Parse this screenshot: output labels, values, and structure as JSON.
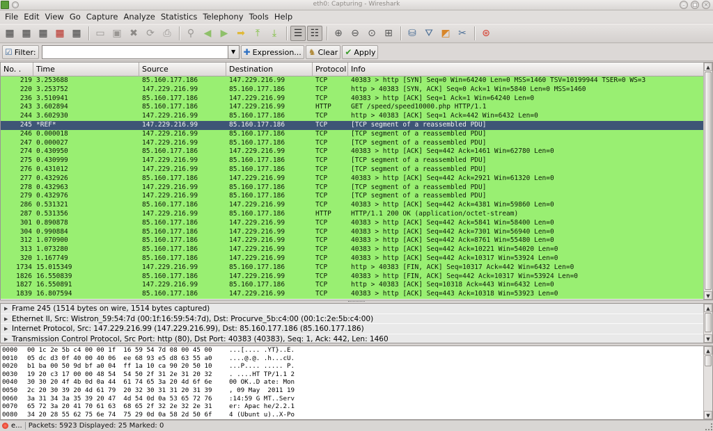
{
  "window": {
    "title": "eth0: Capturing - Wireshark"
  },
  "menu": [
    "File",
    "Edit",
    "View",
    "Go",
    "Capture",
    "Analyze",
    "Statistics",
    "Telephony",
    "Tools",
    "Help"
  ],
  "toolbar": [
    {
      "name": "interfaces-icon",
      "glyph": "▦",
      "color": "#3a3a3a"
    },
    {
      "name": "capture-options-icon",
      "glyph": "▦",
      "color": "#3a3a3a"
    },
    {
      "name": "start-capture-icon",
      "glyph": "▦",
      "color": "#3a3a3a"
    },
    {
      "name": "stop-capture-icon",
      "glyph": "▦",
      "color": "#b7261d"
    },
    {
      "name": "restart-capture-icon",
      "glyph": "▦",
      "color": "#3a3a3a"
    },
    {
      "sep": true
    },
    {
      "name": "open-icon",
      "glyph": "▭",
      "color": "#9a9794"
    },
    {
      "name": "save-icon",
      "glyph": "▣",
      "color": "#9a9794"
    },
    {
      "name": "close-file-icon",
      "glyph": "✖",
      "color": "#8c8986"
    },
    {
      "name": "reload-icon",
      "glyph": "⟳",
      "color": "#9a9794"
    },
    {
      "name": "print-icon",
      "glyph": "⎙",
      "color": "#9a9794"
    },
    {
      "sep": true
    },
    {
      "name": "find-icon",
      "glyph": "⚲",
      "color": "#9a9794"
    },
    {
      "name": "back-icon",
      "glyph": "◀",
      "color": "#8fc06a"
    },
    {
      "name": "forward-icon",
      "glyph": "▶",
      "color": "#8fc06a"
    },
    {
      "name": "go-to-packet-icon",
      "glyph": "➡",
      "color": "#e0b93a"
    },
    {
      "name": "first-packet-icon",
      "glyph": "⤒",
      "color": "#7bbf3a"
    },
    {
      "name": "last-packet-icon",
      "glyph": "⤓",
      "color": "#7bbf3a"
    },
    {
      "sep": true
    },
    {
      "name": "colorize-icon",
      "glyph": "☰",
      "color": "#2f2f2f",
      "pressed": true
    },
    {
      "name": "auto-scroll-icon",
      "glyph": "☷",
      "color": "#2f2f2f",
      "pressed": true
    },
    {
      "sep": true
    },
    {
      "name": "zoom-in-icon",
      "glyph": "⊕",
      "color": "#555"
    },
    {
      "name": "zoom-out-icon",
      "glyph": "⊖",
      "color": "#555"
    },
    {
      "name": "normal-size-icon",
      "glyph": "⊙",
      "color": "#555"
    },
    {
      "name": "resize-columns-icon",
      "glyph": "⊞",
      "color": "#555"
    },
    {
      "sep": true
    },
    {
      "name": "capture-filters-icon",
      "glyph": "⛁",
      "color": "#4b6e96"
    },
    {
      "name": "display-filters-icon",
      "glyph": "⛛",
      "color": "#4b6e96"
    },
    {
      "name": "coloring-rules-icon",
      "glyph": "◩",
      "color": "#d8862a"
    },
    {
      "name": "preferences-icon",
      "glyph": "✂",
      "color": "#4b6e96"
    },
    {
      "sep": true
    },
    {
      "name": "help-icon",
      "glyph": "⊛",
      "color": "#d53b2c"
    }
  ],
  "filter": {
    "label": "Filter:",
    "value": "",
    "expression_label": "Expression...",
    "clear_label": "Clear",
    "apply_label": "Apply"
  },
  "packet_list": {
    "columns": [
      "No. .",
      "Time",
      "Source",
      "Destination",
      "Protocol",
      "Info"
    ],
    "selected_no": "245",
    "rows": [
      [
        "219",
        "3.253688",
        "85.160.177.186",
        "147.229.216.99",
        "TCP",
        "40383 > http [SYN] Seq=0 Win=64240 Len=0 MSS=1460 TSV=10199944 TSER=0 WS=3"
      ],
      [
        "220",
        "3.253752",
        "147.229.216.99",
        "85.160.177.186",
        "TCP",
        "http > 40383 [SYN, ACK] Seq=0 Ack=1 Win=5840 Len=0 MSS=1460"
      ],
      [
        "236",
        "3.510941",
        "85.160.177.186",
        "147.229.216.99",
        "TCP",
        "40383 > http [ACK] Seq=1 Ack=1 Win=64240 Len=0"
      ],
      [
        "243",
        "3.602894",
        "85.160.177.186",
        "147.229.216.99",
        "HTTP",
        "GET /speed/speed10000.php HTTP/1.1"
      ],
      [
        "244",
        "3.602930",
        "147.229.216.99",
        "85.160.177.186",
        "TCP",
        "http > 40383 [ACK] Seq=1 Ack=442 Win=6432 Len=0"
      ],
      [
        "245",
        "*REF*",
        "147.229.216.99",
        "85.160.177.186",
        "TCP",
        "[TCP segment of a reassembled PDU]"
      ],
      [
        "246",
        "0.000018",
        "147.229.216.99",
        "85.160.177.186",
        "TCP",
        "[TCP segment of a reassembled PDU]"
      ],
      [
        "247",
        "0.000027",
        "147.229.216.99",
        "85.160.177.186",
        "TCP",
        "[TCP segment of a reassembled PDU]"
      ],
      [
        "274",
        "0.430950",
        "85.160.177.186",
        "147.229.216.99",
        "TCP",
        "40383 > http [ACK] Seq=442 Ack=1461 Win=62780 Len=0"
      ],
      [
        "275",
        "0.430999",
        "147.229.216.99",
        "85.160.177.186",
        "TCP",
        "[TCP segment of a reassembled PDU]"
      ],
      [
        "276",
        "0.431012",
        "147.229.216.99",
        "85.160.177.186",
        "TCP",
        "[TCP segment of a reassembled PDU]"
      ],
      [
        "277",
        "0.432926",
        "85.160.177.186",
        "147.229.216.99",
        "TCP",
        "40383 > http [ACK] Seq=442 Ack=2921 Win=61320 Len=0"
      ],
      [
        "278",
        "0.432963",
        "147.229.216.99",
        "85.160.177.186",
        "TCP",
        "[TCP segment of a reassembled PDU]"
      ],
      [
        "279",
        "0.432976",
        "147.229.216.99",
        "85.160.177.186",
        "TCP",
        "[TCP segment of a reassembled PDU]"
      ],
      [
        "286",
        "0.531321",
        "85.160.177.186",
        "147.229.216.99",
        "TCP",
        "40383 > http [ACK] Seq=442 Ack=4381 Win=59860 Len=0"
      ],
      [
        "287",
        "0.531356",
        "147.229.216.99",
        "85.160.177.186",
        "HTTP",
        "HTTP/1.1 200 OK  (application/octet-stream)"
      ],
      [
        "301",
        "0.890878",
        "85.160.177.186",
        "147.229.216.99",
        "TCP",
        "40383 > http [ACK] Seq=442 Ack=5841 Win=58400 Len=0"
      ],
      [
        "304",
        "0.990884",
        "85.160.177.186",
        "147.229.216.99",
        "TCP",
        "40383 > http [ACK] Seq=442 Ack=7301 Win=56940 Len=0"
      ],
      [
        "312",
        "1.070900",
        "85.160.177.186",
        "147.229.216.99",
        "TCP",
        "40383 > http [ACK] Seq=442 Ack=8761 Win=55480 Len=0"
      ],
      [
        "313",
        "1.073280",
        "85.160.177.186",
        "147.229.216.99",
        "TCP",
        "40383 > http [ACK] Seq=442 Ack=10221 Win=54020 Len=0"
      ],
      [
        "320",
        "1.167749",
        "85.160.177.186",
        "147.229.216.99",
        "TCP",
        "40383 > http [ACK] Seq=442 Ack=10317 Win=53924 Len=0"
      ],
      [
        "1734",
        "15.015349",
        "147.229.216.99",
        "85.160.177.186",
        "TCP",
        "http > 40383 [FIN, ACK] Seq=10317 Ack=442 Win=6432 Len=0"
      ],
      [
        "1826",
        "16.550839",
        "85.160.177.186",
        "147.229.216.99",
        "TCP",
        "40383 > http [FIN, ACK] Seq=442 Ack=10317 Win=53924 Len=0"
      ],
      [
        "1827",
        "16.550891",
        "147.229.216.99",
        "85.160.177.186",
        "TCP",
        "http > 40383 [ACK] Seq=10318 Ack=443 Win=6432 Len=0"
      ],
      [
        "1839",
        "16.807594",
        "85.160.177.186",
        "147.229.216.99",
        "TCP",
        "40383 > http [ACK] Seq=443 Ack=10318 Win=53923 Len=0"
      ]
    ]
  },
  "details": [
    "Frame 245 (1514 bytes on wire, 1514 bytes captured)",
    "Ethernet II, Src: Wistron_59:54:7d (00:1f:16:59:54:7d), Dst: Procurve_5b:c4:00 (00:1c:2e:5b:c4:00)",
    "Internet Protocol, Src: 147.229.216.99 (147.229.216.99), Dst: 85.160.177.186 (85.160.177.186)",
    "Transmission Control Protocol, Src Port: http (80), Dst Port: 40383 (40383), Seq: 1, Ack: 442, Len: 1460"
  ],
  "hex": [
    [
      "0000",
      "00 1c 2e 5b c4 00 00 1f  16 59 54 7d 08 00 45 00",
      "...[.... .YT}..E."
    ],
    [
      "0010",
      "05 dc d3 0f 40 00 40 06  ee 68 93 e5 d8 63 55 a0",
      "....@.@. .h...cU."
    ],
    [
      "0020",
      "b1 ba 00 50 9d bf a0 04  ff 1a 10 ca 90 20 50 10",
      "...P.... ..... P."
    ],
    [
      "0030",
      "19 20 c3 17 00 00 48 54  54 50 2f 31 2e 31 20 32",
      ". ....HT TP/1.1 2"
    ],
    [
      "0040",
      "30 30 20 4f 4b 0d 0a 44  61 74 65 3a 20 4d 6f 6e",
      "00 OK..D ate: Mon"
    ],
    [
      "0050",
      "2c 20 30 39 20 4d 61 79  20 32 30 31 31 20 31 39",
      ", 09 May  2011 19"
    ],
    [
      "0060",
      "3a 31 34 3a 35 39 20 47  4d 54 0d 0a 53 65 72 76",
      ":14:59 G MT..Serv"
    ],
    [
      "0070",
      "65 72 3a 20 41 70 61 63  68 65 2f 32 2e 32 2e 31",
      "er: Apac he/2.2.1"
    ],
    [
      "0080",
      "34 20 28 55 62 75 6e 74  75 29 0d 0a 58 2d 50 6f",
      "4 (Ubunt u)..X-Po"
    ]
  ],
  "status": {
    "expert_label": "e...",
    "text": "Packets: 5923 Displayed: 25 Marked: 0"
  },
  "colors": {
    "row_green": "#99ef72",
    "row_selected": "#3e5576",
    "expert_red": "#d7260f"
  }
}
